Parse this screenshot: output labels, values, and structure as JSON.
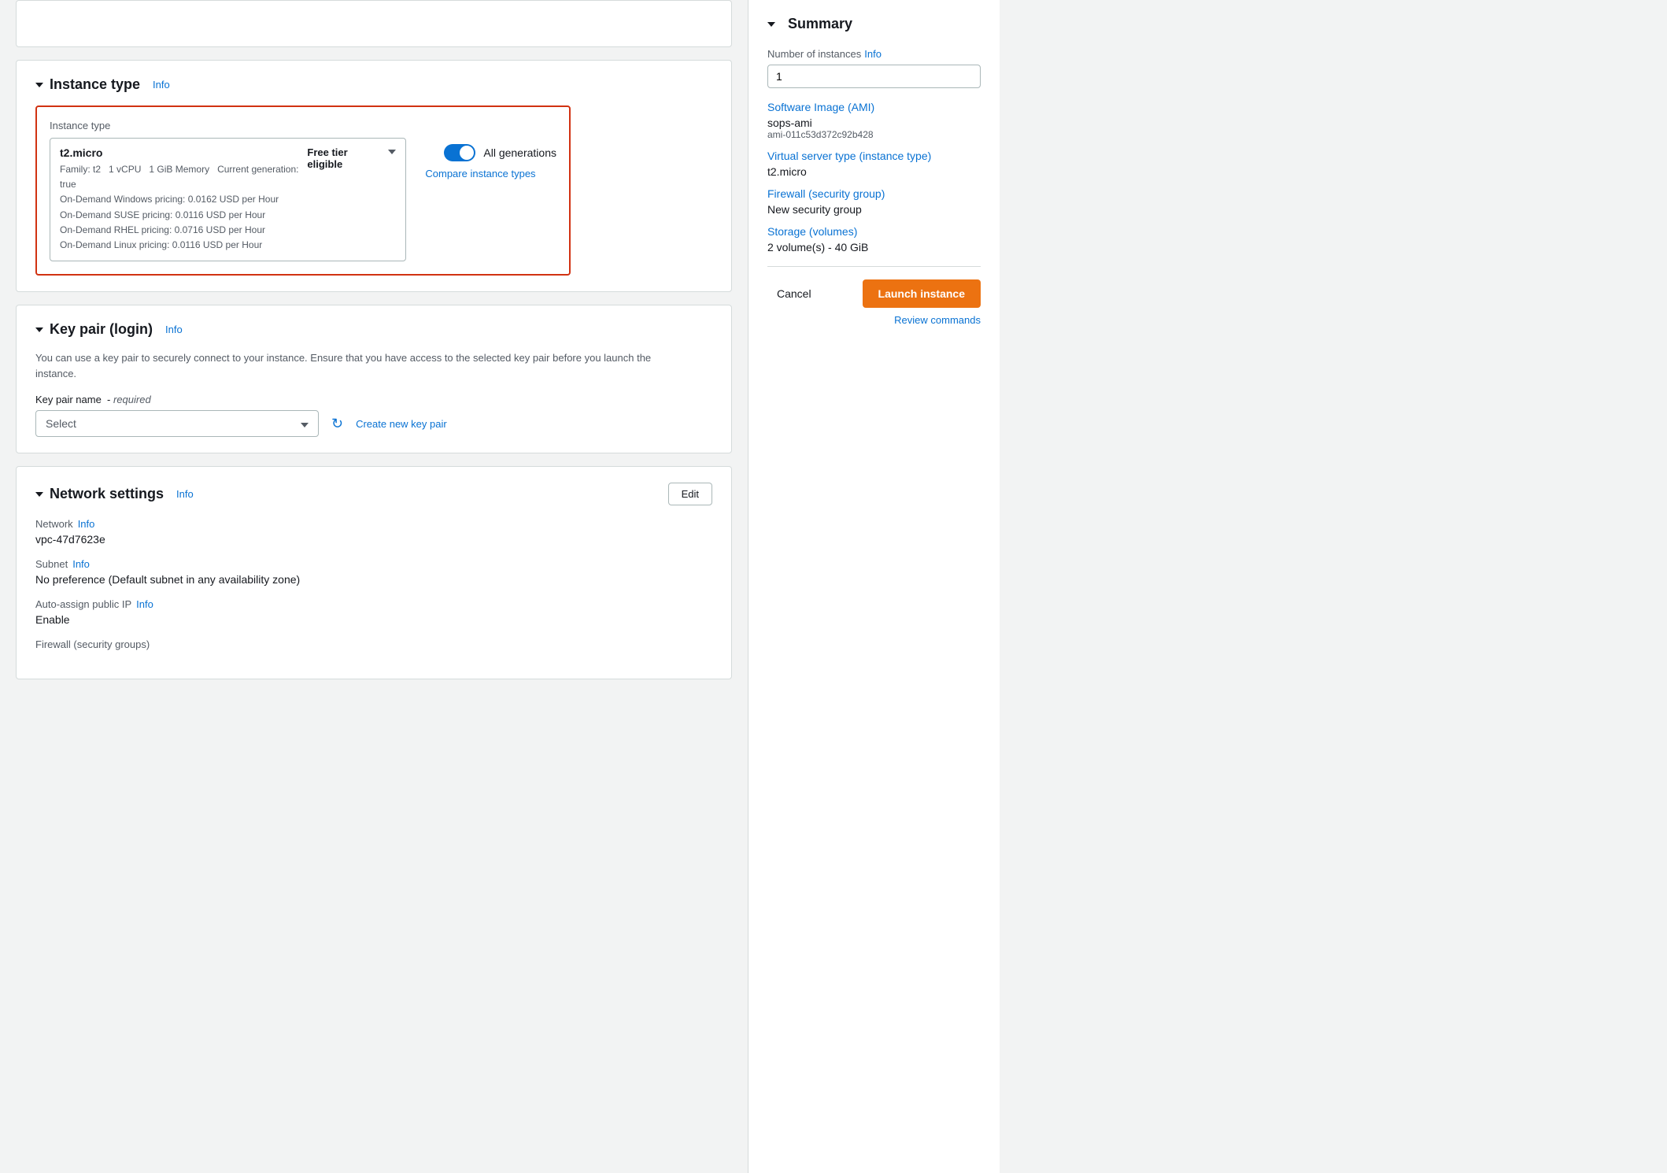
{
  "page": {
    "topbar_height": 40
  },
  "instance_type_section": {
    "title": "Instance type",
    "info_label": "Info",
    "field_label": "Instance type",
    "instance": {
      "name": "t2.micro",
      "free_tier": "Free tier eligible",
      "family": "Family: t2",
      "vcpu": "1 vCPU",
      "memory": "1 GiB Memory",
      "generation": "Current generation: true",
      "windows_pricing": "On-Demand Windows pricing: 0.0162 USD per Hour",
      "suse_pricing": "On-Demand SUSE pricing: 0.0116 USD per Hour",
      "rhel_pricing": "On-Demand RHEL pricing: 0.0716 USD per Hour",
      "linux_pricing": "On-Demand Linux pricing: 0.0116 USD per Hour"
    },
    "all_generations_label": "All generations",
    "compare_link": "Compare instance types"
  },
  "key_pair_section": {
    "title": "Key pair (login)",
    "info_label": "Info",
    "description": "You can use a key pair to securely connect to your instance. Ensure that you have access to the selected key pair before you launch the instance.",
    "field_label": "Key pair name",
    "required_text": "required",
    "select_placeholder": "Select",
    "create_link": "Create new key pair"
  },
  "network_section": {
    "title": "Network settings",
    "info_label": "Info",
    "edit_label": "Edit",
    "network_label": "Network",
    "network_info": "Info",
    "network_value": "vpc-47d7623e",
    "subnet_label": "Subnet",
    "subnet_info": "Info",
    "subnet_value": "No preference (Default subnet in any availability zone)",
    "auto_assign_label": "Auto-assign public IP",
    "auto_assign_info": "Info",
    "auto_assign_value": "Enable",
    "firewall_label": "Firewall (security groups)"
  },
  "summary": {
    "title": "Summary",
    "num_instances_label": "Number of instances",
    "info_label": "Info",
    "num_instances_value": "1",
    "ami_title": "Software Image (AMI)",
    "ami_name": "sops-ami",
    "ami_id": "ami-011c53d372c92b428",
    "instance_type_title": "Virtual server type (instance type)",
    "instance_type_value": "t2.micro",
    "firewall_title": "Firewall (security group)",
    "firewall_value": "New security group",
    "storage_title": "Storage (volumes)",
    "storage_value": "2 volume(s) - 40 GiB",
    "cancel_label": "Cancel",
    "launch_label": "Launch instance",
    "review_label": "Review commands"
  }
}
